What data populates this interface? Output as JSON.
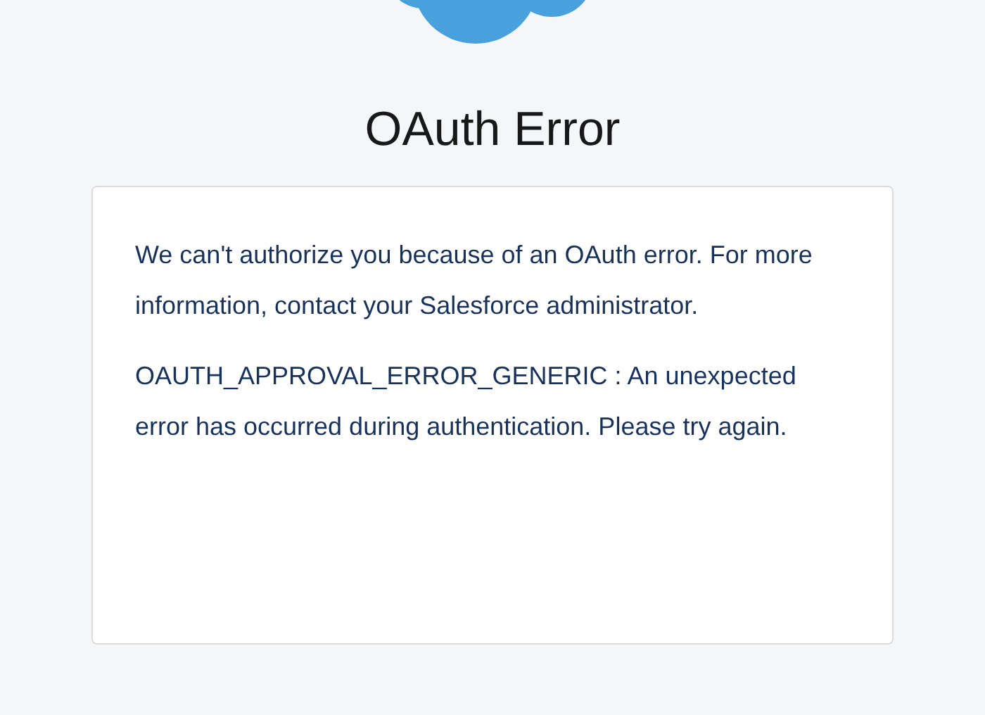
{
  "title": "OAuth Error",
  "paragraphs": [
    "We can't authorize you because of an OAuth error. For more information, contact your Salesforce administrator.",
    "OAUTH_APPROVAL_ERROR_GENERIC : An unexpected error has occurred during authentication. Please try again."
  ]
}
